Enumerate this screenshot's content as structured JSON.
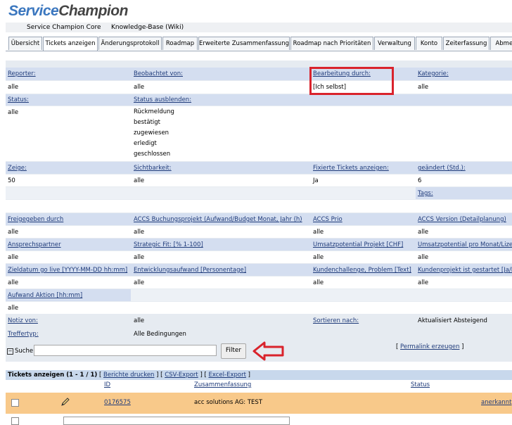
{
  "logo": {
    "part1": "Service",
    "part2": "Champion"
  },
  "projects": {
    "core": "Service Champion Core",
    "wiki": "Knowledge-Base (Wiki)"
  },
  "tabs": [
    "Übersicht",
    "Tickets anzeigen",
    "Änderungsprotokoll",
    "Roadmap",
    "Erweiterte Zusammenfassung",
    "Roadmap nach Prioritäten",
    "Verwaltung",
    "Konto",
    "Zeiterfassung",
    "Abmel"
  ],
  "filters": {
    "r1": {
      "h1": "Reporter:",
      "h2": "Beobachtet von:",
      "h3": "Bearbeitung durch:",
      "h4": "Kategorie:",
      "v1": "alle",
      "v2": "alle",
      "v3": "[Ich selbst]",
      "v4": "alle"
    },
    "r2": {
      "h1": "Status:",
      "h2": "Status ausblenden:",
      "v1": "alle",
      "hide": [
        "Rückmeldung",
        "bestätigt",
        "zugewiesen",
        "erledigt",
        "geschlossen"
      ]
    },
    "r3": {
      "h1": "Zeige:",
      "h2": "Sichtbarkeit:",
      "h3": "Fixierte Tickets anzeigen:",
      "h4": "geändert (Std.):",
      "v1": "50",
      "v2": "alle",
      "v3": "Ja",
      "v4": "6"
    },
    "r4": {
      "h4": "Tags:"
    },
    "r5": {
      "h1": "Freigegeben durch",
      "h2": "ACCS Buchungsprojekt (Aufwand/Budget Monat, Jahr (h)",
      "h3": "ACCS Prio",
      "h4": "ACCS Version (Detailplanung)",
      "v1": "alle",
      "v2": "alle",
      "v3": "alle",
      "v4": "alle"
    },
    "r6": {
      "h1": "Ansprechspartner",
      "h2": "Strategic Fit: [% 1-100]",
      "h3": "Umsatzpotential Projekt [CHF]",
      "h4": "Umsatzpotential pro Monat/Lizenz",
      "v1": "alle",
      "v2": "alle",
      "v3": "alle",
      "v4": "alle"
    },
    "r7": {
      "h1": "Zieldatum go live [YYYY-MM-DD hh:mm]",
      "h2": "Entwicklungsaufwand [Personentage]",
      "h3": "Kundenchallenge, Problem [Text]",
      "h4": "Kundenprojekt ist gestartet [Ja/Nei",
      "v1": "alle",
      "v2": "alle",
      "v3": "alle",
      "v4": "alle"
    },
    "r8": {
      "h1": "Aufwand Aktion [hh:mm]",
      "v1": "alle"
    },
    "r9": {
      "h1": "Notiz von:",
      "v2": "alle",
      "h3": "Sortieren nach:",
      "v4": "Aktualisiert Absteigend"
    },
    "r10": {
      "h1": "Treffertyp:",
      "v2": "Alle Bedingungen"
    }
  },
  "search": {
    "label": "Suche",
    "value": "",
    "button": "Filter",
    "permalink": "Permalink erzeugen"
  },
  "results": {
    "title": "Tickets anzeigen (1 - 1 / 1)",
    "links": [
      "Berichte drucken",
      "CSV-Export",
      "Excel-Export"
    ],
    "columns": {
      "id": "ID",
      "summary": "Zusammenfassung",
      "status": "Status"
    },
    "ticket": {
      "id": "0176575",
      "summary": "acc solutions AG: TEST",
      "status": "anerkannt"
    }
  },
  "colors": {
    "highlight": "#d9232c",
    "ticket_row": "#f8c98a",
    "header": "#d4def0"
  }
}
